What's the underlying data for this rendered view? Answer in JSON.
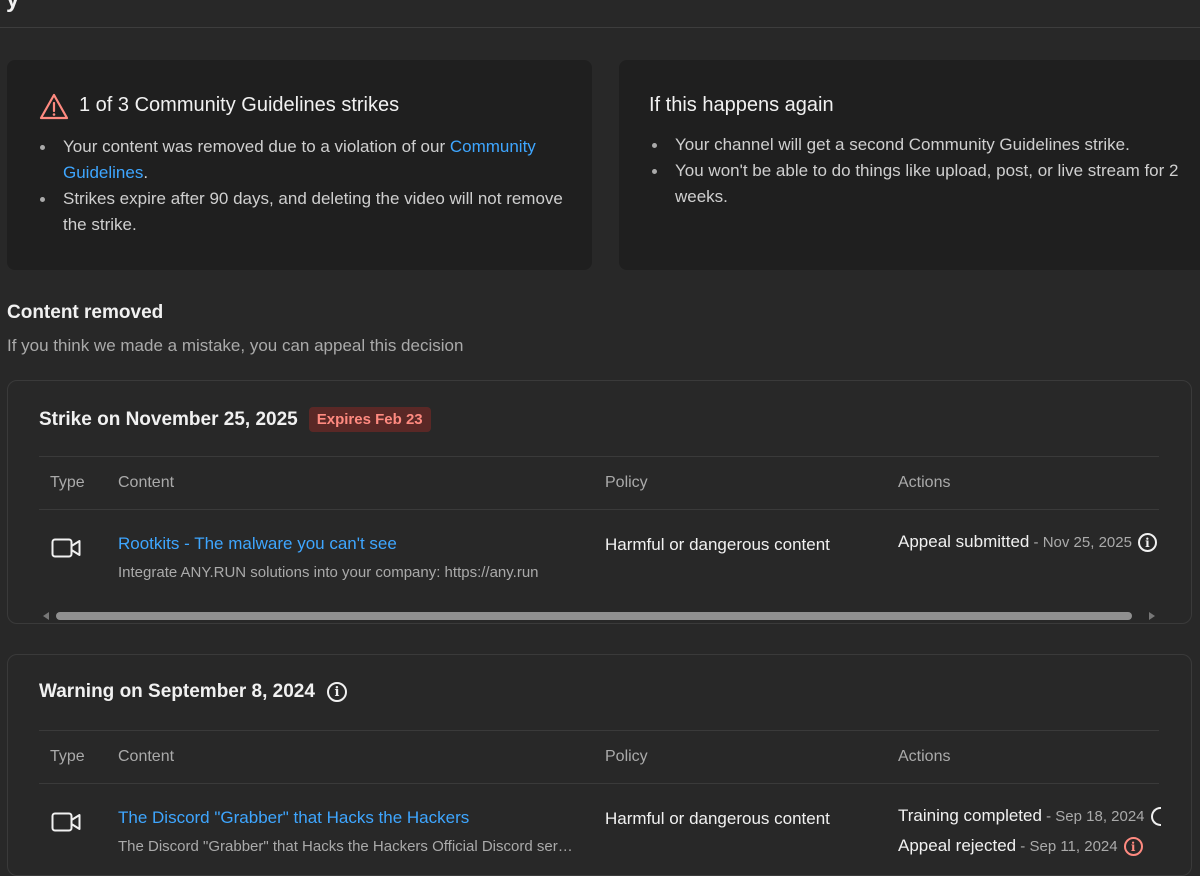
{
  "strikes_card": {
    "title": "1 of 3 Community Guidelines strikes",
    "bullet1_prefix": "Your content was removed due to a violation of our ",
    "bullet1_link": "Community Guidelines",
    "bullet1_suffix": ".",
    "bullet2": "Strikes expire after 90 days, and deleting the video will not remove the strike.",
    "icon": "warning-triangle-icon",
    "icon_color": "#ff8a80"
  },
  "again_card": {
    "title": "If this happens again",
    "bullets": [
      "Your channel will get a second Community Guidelines strike.",
      "You won't be able to do things like upload, post, or live stream for 2 weeks."
    ]
  },
  "section": {
    "title": "Content removed",
    "subtitle": "If you think we made a mistake, you can appeal this decision"
  },
  "columns": {
    "type": "Type",
    "content": "Content",
    "policy": "Policy",
    "actions": "Actions"
  },
  "strike_panel": {
    "title": "Strike on November 25, 2025",
    "badge": "Expires Feb 23",
    "row": {
      "type_icon": "video-camera-icon",
      "video_title": "Rootkits - The malware you can't see",
      "description": "Integrate ANY.RUN solutions into your company: https://any.run",
      "policy": "Harmful or dangerous content",
      "action": "Appeal submitted",
      "action_date": " - Nov 25, 2025"
    }
  },
  "warning_panel": {
    "title": "Warning on September 8, 2024",
    "row": {
      "type_icon": "video-camera-icon",
      "video_title": "The Discord \"Grabber\" that Hacks the Hackers",
      "description": "The Discord \"Grabber\" that Hacks the Hackers Official Discord server",
      "policy": "Harmful or dangerous content",
      "action1": "Training completed",
      "action1_date": " - Sep 18, 2024",
      "action2": "Appeal rejected",
      "action2_date": " - Sep 11, 2024"
    }
  },
  "colors": {
    "background": "#282828",
    "card": "#1f1f1f",
    "link": "#3ea6ff",
    "badge_bg": "#5a2826",
    "badge_text": "#ff8a80"
  }
}
